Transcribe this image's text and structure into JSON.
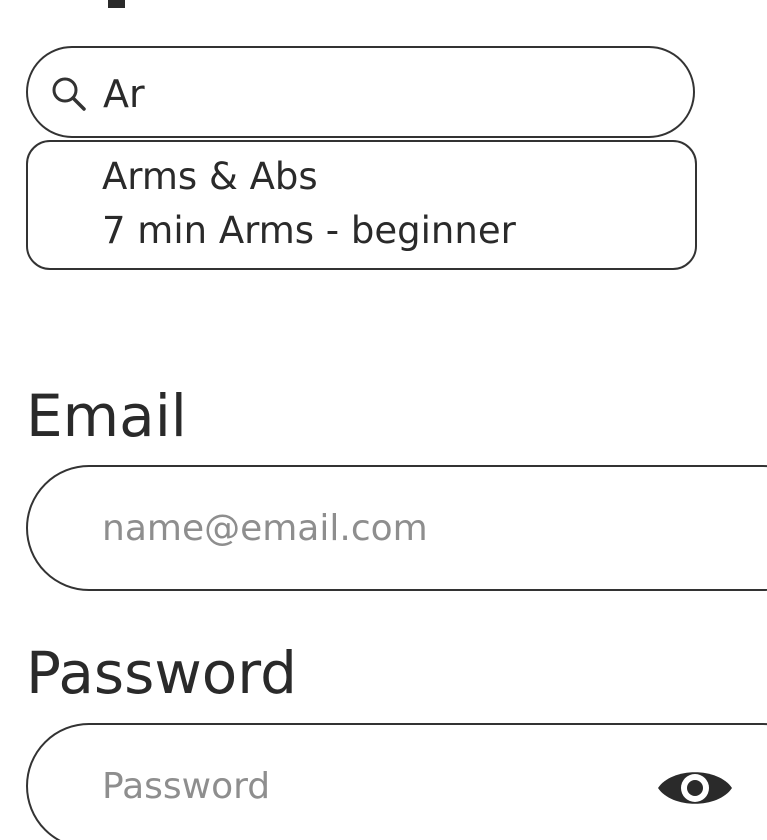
{
  "search": {
    "value": "Ar",
    "icon": "search-icon",
    "suggestions": [
      {
        "label": "Arms & Abs"
      },
      {
        "label": "7 min Arms - beginner"
      }
    ]
  },
  "email": {
    "label": "Email",
    "placeholder": "name@email.com"
  },
  "password": {
    "label": "Password",
    "placeholder": "Password",
    "toggle_icon": "eye-icon"
  },
  "colors": {
    "border": "#333333",
    "text": "#2a2a2a",
    "placeholder": "#8e8e8e",
    "background": "#ffffff"
  }
}
